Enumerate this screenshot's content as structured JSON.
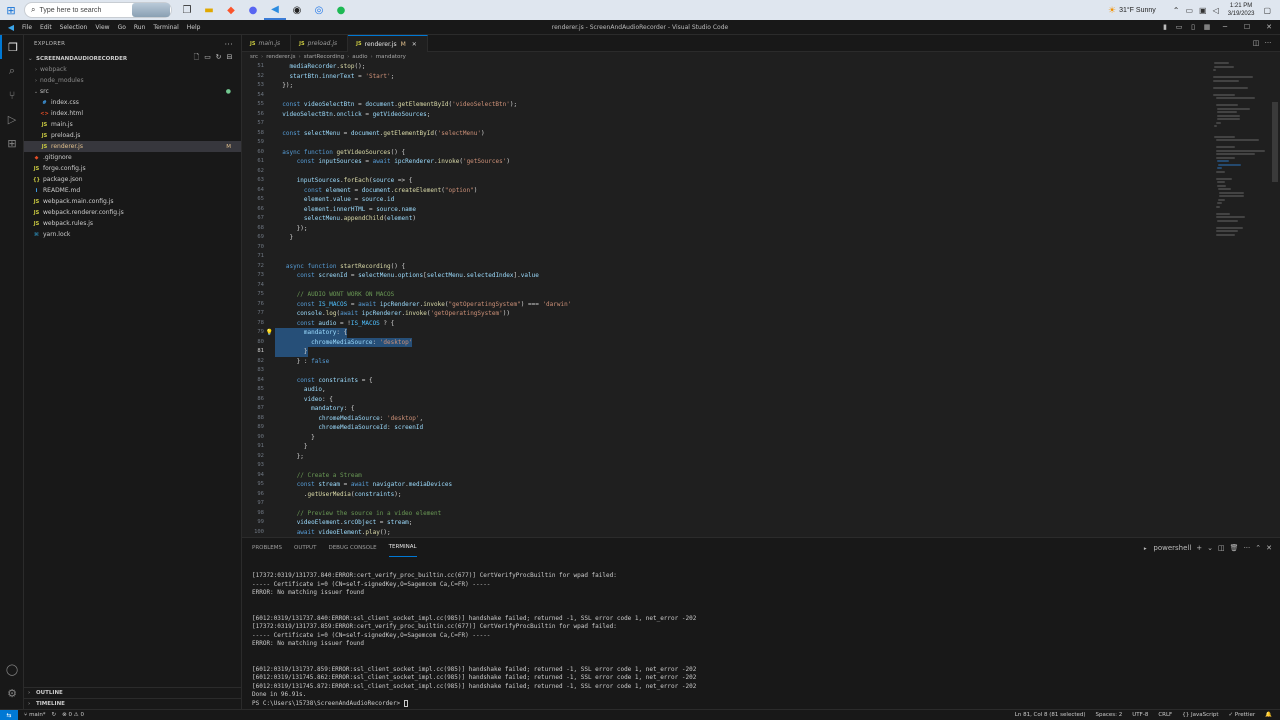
{
  "taskbar": {
    "search_placeholder": "Type here to search",
    "apps": [
      "task-view",
      "file-explorer",
      "brave",
      "discord",
      "vscode",
      "chrome",
      "spotify"
    ],
    "weather": "31°F  Sunny",
    "time": "1:21 PM",
    "date": "3/19/2023"
  },
  "titlebar": {
    "menus": [
      "File",
      "Edit",
      "Selection",
      "View",
      "Go",
      "Run",
      "Terminal",
      "Help"
    ],
    "window_title": "renderer.js - ScreenAndAudioRecorder - Visual Studio Code"
  },
  "sidebar": {
    "header": "EXPLORER",
    "project": "SCREENANDAUDIORECORDER",
    "items": [
      {
        "label": "webpack",
        "type": "folder",
        "indent": 1,
        "dim": true
      },
      {
        "label": "node_modules",
        "type": "folder",
        "indent": 1,
        "dim": true
      },
      {
        "label": "src",
        "type": "folder-open",
        "indent": 1,
        "dim": false
      },
      {
        "label": "index.css",
        "type": "css",
        "indent": 2
      },
      {
        "label": "index.html",
        "type": "html",
        "indent": 2
      },
      {
        "label": "main.js",
        "type": "js",
        "indent": 2
      },
      {
        "label": "preload.js",
        "type": "js",
        "indent": 2
      },
      {
        "label": "renderer.js",
        "type": "js",
        "indent": 2,
        "selected": true,
        "badge": "M"
      },
      {
        "label": ".gitignore",
        "type": "git",
        "indent": 1
      },
      {
        "label": "forge.config.js",
        "type": "js",
        "indent": 1
      },
      {
        "label": "package.json",
        "type": "json",
        "indent": 1
      },
      {
        "label": "README.md",
        "type": "md",
        "indent": 1
      },
      {
        "label": "webpack.main.config.js",
        "type": "js",
        "indent": 1
      },
      {
        "label": "webpack.renderer.config.js",
        "type": "js",
        "indent": 1
      },
      {
        "label": "webpack.rules.js",
        "type": "js",
        "indent": 1
      },
      {
        "label": "yarn.lock",
        "type": "yarn",
        "indent": 1
      }
    ],
    "outline": "OUTLINE",
    "timeline": "TIMELINE"
  },
  "editor": {
    "tabs": [
      {
        "label": "main.js",
        "active": false
      },
      {
        "label": "preload.js",
        "active": false
      },
      {
        "label": "renderer.js",
        "active": true,
        "modified": "M"
      }
    ],
    "breadcrumb": [
      "src",
      "renderer.js",
      "startRecording",
      "audio",
      "mandatory"
    ],
    "lines": [
      {
        "n": "51",
        "t": "    mediaRecorder.stop();"
      },
      {
        "n": "52",
        "t": "    startBtn.innerText = 'Start';"
      },
      {
        "n": "53",
        "t": "  });"
      },
      {
        "n": "54",
        "t": ""
      },
      {
        "n": "55",
        "t": "  const videoSelectBtn = document.getElementById('videoSelectBtn');"
      },
      {
        "n": "56",
        "t": "  videoSelectBtn.onclick = getVideoSources;"
      },
      {
        "n": "57",
        "t": ""
      },
      {
        "n": "58",
        "t": "  const selectMenu = document.getElementById('selectMenu')"
      },
      {
        "n": "59",
        "t": ""
      },
      {
        "n": "60",
        "t": "  async function getVideoSources() {"
      },
      {
        "n": "61",
        "t": "      const inputSources = await ipcRenderer.invoke('getSources')"
      },
      {
        "n": "62",
        "t": ""
      },
      {
        "n": "63",
        "t": "      inputSources.forEach(source => {"
      },
      {
        "n": "64",
        "t": "        const element = document.createElement(\"option\")"
      },
      {
        "n": "65",
        "t": "        element.value = source.id"
      },
      {
        "n": "66",
        "t": "        element.innerHTML = source.name"
      },
      {
        "n": "67",
        "t": "        selectMenu.appendChild(element)"
      },
      {
        "n": "68",
        "t": "      });"
      },
      {
        "n": "69",
        "t": "    }"
      },
      {
        "n": "70",
        "t": ""
      },
      {
        "n": "71",
        "t": ""
      },
      {
        "n": "72",
        "t": "   async function startRecording() {"
      },
      {
        "n": "73",
        "t": "      const screenId = selectMenu.options[selectMenu.selectedIndex].value"
      },
      {
        "n": "74",
        "t": ""
      },
      {
        "n": "75",
        "t": "      // AUDIO WONT WORK ON MACOS"
      },
      {
        "n": "76",
        "t": "      const IS_MACOS = await ipcRenderer.invoke(\"getOperatingSystem\") === 'darwin'"
      },
      {
        "n": "77",
        "t": "      console.log(await ipcRenderer.invoke('getOperatingSystem'))"
      },
      {
        "n": "78",
        "t": "      const audio = !IS_MACOS ? {"
      },
      {
        "n": "79",
        "t": "        mandatory: {",
        "sel": true,
        "bulb": true
      },
      {
        "n": "80",
        "t": "          chromeMediaSource: 'desktop'",
        "sel": true
      },
      {
        "n": "81",
        "t": "        }",
        "sel": true,
        "current": true
      },
      {
        "n": "82",
        "t": "      } : false"
      },
      {
        "n": "83",
        "t": ""
      },
      {
        "n": "84",
        "t": "      const constraints = {"
      },
      {
        "n": "85",
        "t": "        audio,"
      },
      {
        "n": "86",
        "t": "        video: {"
      },
      {
        "n": "87",
        "t": "          mandatory: {"
      },
      {
        "n": "88",
        "t": "            chromeMediaSource: 'desktop',"
      },
      {
        "n": "89",
        "t": "            chromeMediaSourceId: screenId"
      },
      {
        "n": "90",
        "t": "          }"
      },
      {
        "n": "91",
        "t": "        }"
      },
      {
        "n": "92",
        "t": "      };"
      },
      {
        "n": "93",
        "t": ""
      },
      {
        "n": "94",
        "t": "      // Create a Stream"
      },
      {
        "n": "95",
        "t": "      const stream = await navigator.mediaDevices"
      },
      {
        "n": "96",
        "t": "        .getUserMedia(constraints);"
      },
      {
        "n": "97",
        "t": ""
      },
      {
        "n": "98",
        "t": "      // Preview the source in a video element"
      },
      {
        "n": "99",
        "t": "      videoElement.srcObject = stream;"
      },
      {
        "n": "100",
        "t": "      await videoElement.play();"
      }
    ]
  },
  "panel": {
    "tabs": [
      {
        "label": "PROBLEMS",
        "active": false
      },
      {
        "label": "OUTPUT",
        "active": false
      },
      {
        "label": "DEBUG CONSOLE",
        "active": false
      },
      {
        "label": "TERMINAL",
        "active": true
      }
    ],
    "shell": "powershell",
    "terminal_lines": [
      "[17372:0319/131737.840:ERROR:cert_verify_proc_builtin.cc(677)] CertVerifyProcBuiltin for wpad failed:",
      "----- Certificate i=0 (CN=self-signedKey,O=Sagemcom Ca,C=FR) -----",
      "ERROR: No matching issuer found",
      "",
      "",
      "[6012:0319/131737.840:ERROR:ssl_client_socket_impl.cc(985)] handshake failed; returned -1, SSL error code 1, net_error -202",
      "[17372:0319/131737.859:ERROR:cert_verify_proc_builtin.cc(677)] CertVerifyProcBuiltin for wpad failed:",
      "----- Certificate i=0 (CN=self-signedKey,O=Sagemcom Ca,C=FR) -----",
      "ERROR: No matching issuer found",
      "",
      "",
      "[6012:0319/131737.859:ERROR:ssl_client_socket_impl.cc(985)] handshake failed; returned -1, SSL error code 1, net_error -202",
      "[6012:0319/131745.862:ERROR:ssl_client_socket_impl.cc(985)] handshake failed; returned -1, SSL error code 1, net_error -202",
      "[6012:0319/131745.872:ERROR:ssl_client_socket_impl.cc(985)] handshake failed; returned -1, SSL error code 1, net_error -202",
      "Done in 96.91s."
    ],
    "prompt": "PS C:\\Users\\15738\\ScreenAndAudioRecorder> "
  },
  "statusbar": {
    "branch": "main*",
    "errors": "0",
    "warnings": "0",
    "position": "Ln 81, Col 8 (81 selected)",
    "spaces": "Spaces: 2",
    "encoding": "UTF-8",
    "eol": "CRLF",
    "language": "{} JavaScript",
    "formatter": "✓ Prettier"
  },
  "colors": {
    "accent": "#0078d4",
    "selection": "#264f78",
    "modified": "#e2c08d"
  }
}
